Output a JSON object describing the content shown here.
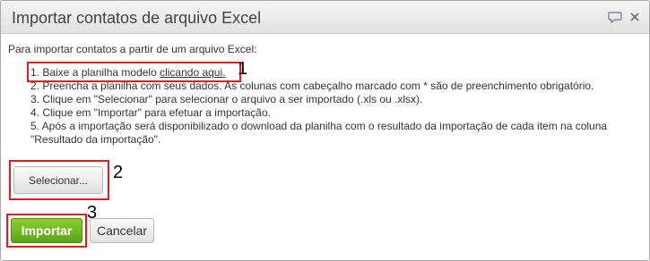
{
  "dialog": {
    "title": "Importar contatos de arquivo Excel",
    "icons": [
      "comment-icon",
      "close-icon"
    ]
  },
  "intro": "Para importar contatos a partir de um arquivo Excel:",
  "steps": {
    "s1_prefix": "1. Baixe a planilha modelo ",
    "s1_link": "clicando aqui.",
    "s2": "2. Preencha a planilha com seus dados. As colunas com cabeçalho marcado com * são de preenchimento obrigatório.",
    "s3": "3. Clique em \"Selecionar\" para selecionar o arquivo a ser importado (.xls ou .xlsx).",
    "s4": "4. Clique em \"Importar\" para efetuar a importação.",
    "s5_line1": "5. Após a importação será disponibilizado o download da planilha com o resultado da importação de cada item na coluna",
    "s5_line2": "\"Resultado da importação\"."
  },
  "buttons": {
    "select": "Selecionar...",
    "import": "Importar",
    "cancel": "Cancelar"
  },
  "annotations": [
    "1",
    "2",
    "3"
  ],
  "colors": {
    "annotation_red": "#d81e1e",
    "primary_green": "#6cb51f"
  }
}
